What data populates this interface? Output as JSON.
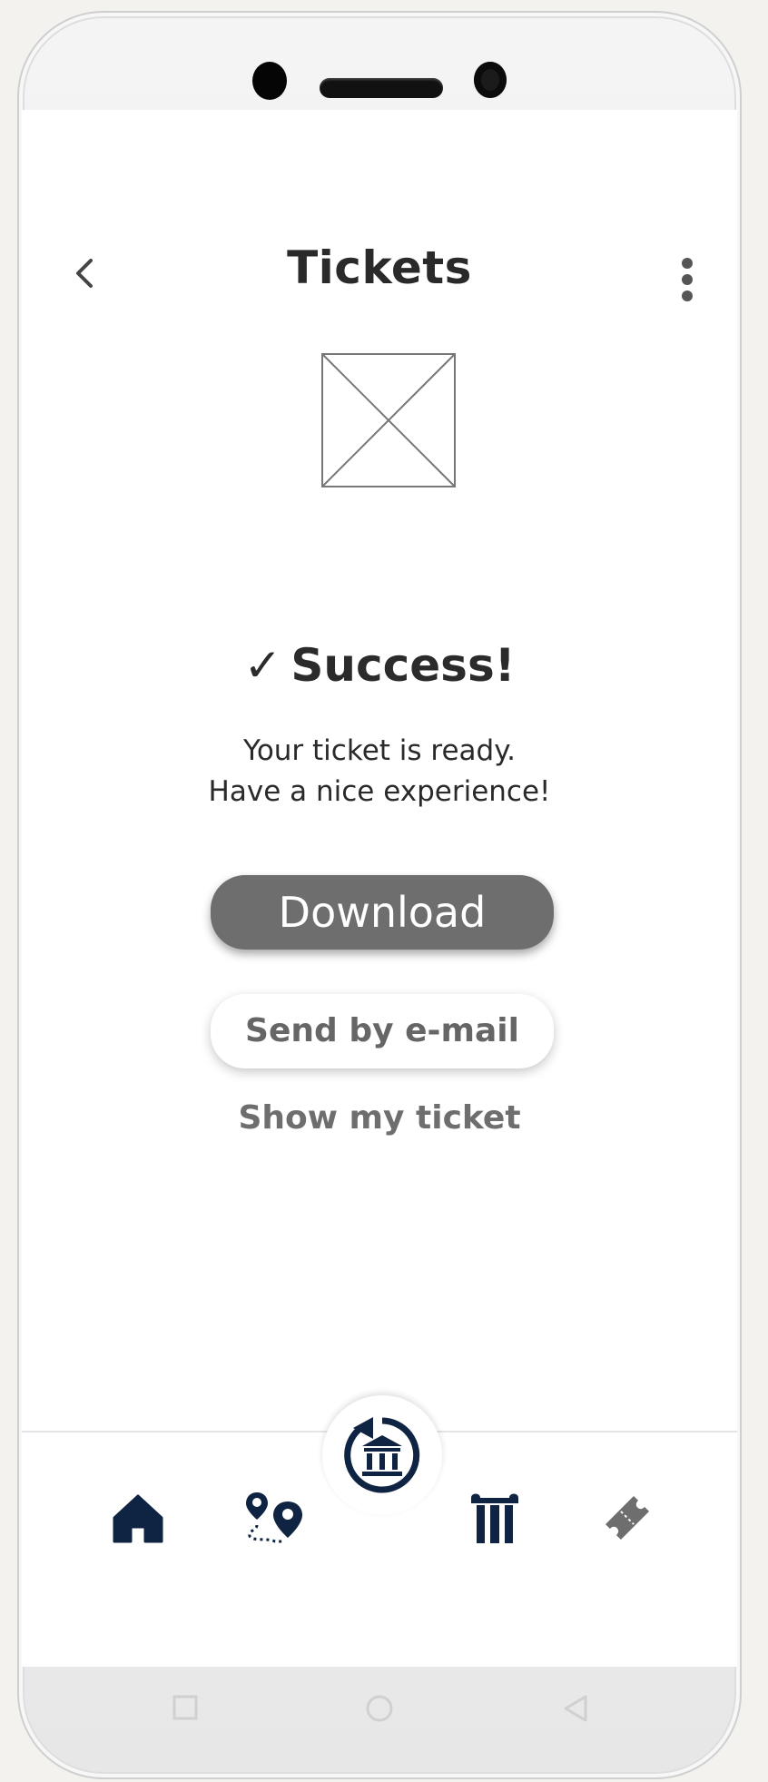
{
  "header": {
    "title": "Tickets",
    "back_icon": "chevron-left-icon",
    "more_icon": "more-vertical-icon"
  },
  "status": {
    "check": "✓",
    "title": "Success!",
    "message_line1": "Your ticket is ready.",
    "message_line2": "Have a nice experience!"
  },
  "actions": {
    "download_label": "Download",
    "email_label": "Send by e-mail",
    "show_label": "Show my ticket"
  },
  "tabbar": {
    "items": [
      {
        "icon": "home-icon"
      },
      {
        "icon": "route-map-icon"
      },
      {
        "icon": "museum-history-icon"
      },
      {
        "icon": "columns-icon"
      },
      {
        "icon": "ticket-icon"
      }
    ]
  },
  "colors": {
    "primary_button": "#6e6e6e",
    "nav_icon": "#0f2342",
    "ticket_icon": "#6e6e6e",
    "text": "#2a2a2a"
  }
}
